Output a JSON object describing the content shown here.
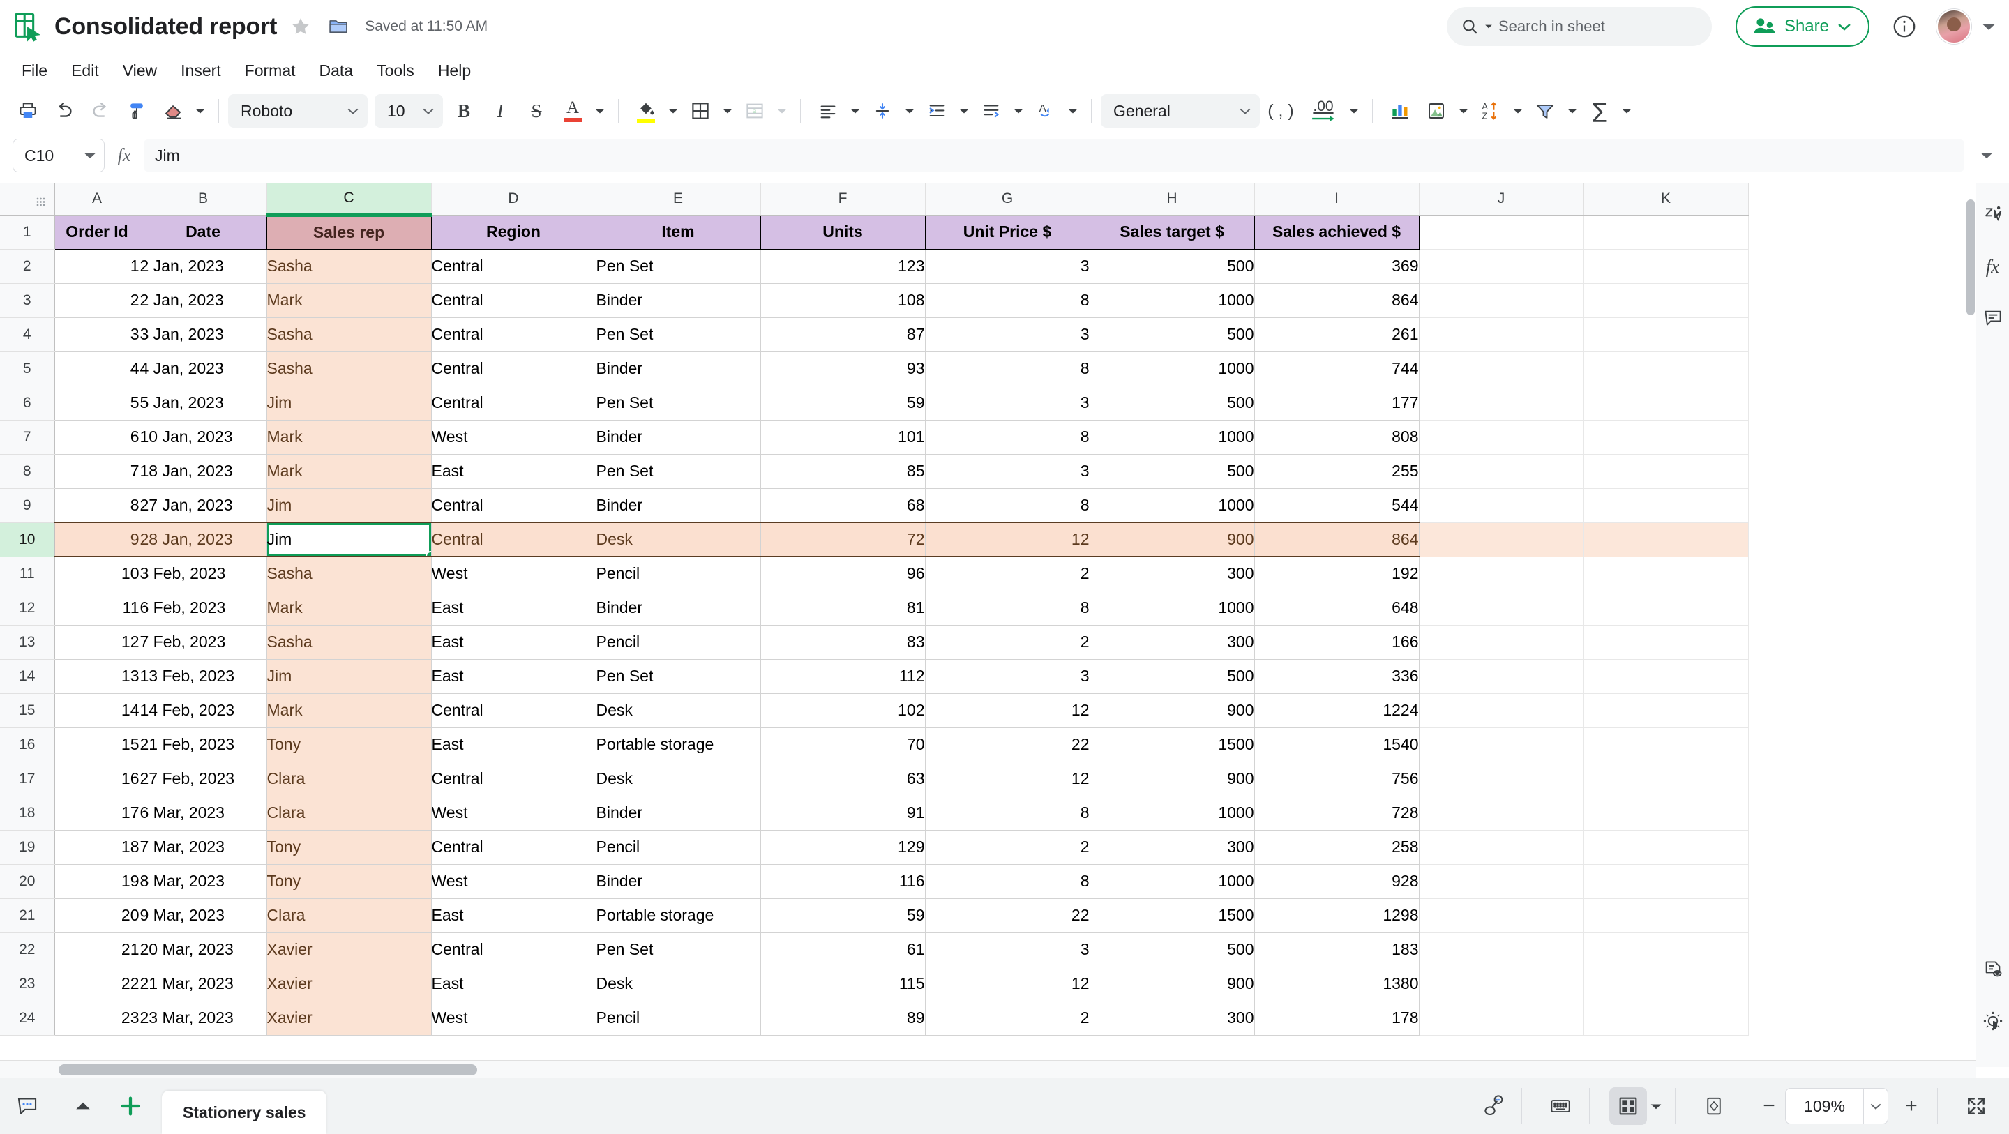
{
  "header": {
    "doc_title": "Consolidated report",
    "saved_status": "Saved at 11:50 AM",
    "star_icon": "star-icon",
    "folder_icon": "folder-icon",
    "logo_icon": "sheets-logo-icon",
    "search_placeholder": "Search in sheet",
    "search_icon": "search-icon",
    "share_label": "Share",
    "share_icon": "people-icon",
    "info_icon": "info-icon",
    "avatar_name": "avatar",
    "accent_green": "#0f9d58"
  },
  "menubar": {
    "items": [
      {
        "label": "File"
      },
      {
        "label": "Edit"
      },
      {
        "label": "View"
      },
      {
        "label": "Insert"
      },
      {
        "label": "Format"
      },
      {
        "label": "Data"
      },
      {
        "label": "Tools"
      },
      {
        "label": "Help"
      }
    ]
  },
  "toolbar": {
    "print_icon": "print-icon",
    "undo_icon": "undo-icon",
    "redo_icon": "redo-icon",
    "paint_format_icon": "paint-roller-icon",
    "clear_format_icon": "eraser-icon",
    "font_family": "Roboto",
    "font_size": "10",
    "bold_label": "B",
    "italic_label": "I",
    "strikethrough_label": "S",
    "text_color_label": "A",
    "text_color": "#ea4335",
    "fill_color_icon": "paint-bucket-icon",
    "fill_color": "#ffff00",
    "borders_icon": "borders-icon",
    "merge_icon": "merge-cells-icon",
    "halign_icon": "horizontal-align-icon",
    "valign_icon": "vertical-align-icon",
    "indent_icon": "indent-icon",
    "wrap_icon": "text-wrap-icon",
    "rotate_icon": "text-rotation-icon",
    "number_format": "General",
    "comma_label": "( , )",
    "decimal_label": ".00",
    "chart_icon": "insert-chart-icon",
    "image_icon": "insert-image-icon",
    "sort_icon": "sort-az-icon",
    "filter_icon": "filter-funnel-icon",
    "functions_label": "∑"
  },
  "formulabar": {
    "name_box": "C10",
    "fx_label": "fx",
    "formula_value": "Jim"
  },
  "grid": {
    "columns": [
      "A",
      "B",
      "C",
      "D",
      "E",
      "F",
      "G",
      "H",
      "I",
      "J",
      "K"
    ],
    "selected_column": "C",
    "selected_row": 10,
    "active_cell": "C10",
    "headers": [
      "Order Id",
      "Date",
      "Sales rep",
      "Region",
      "Item",
      "Units",
      "Unit Price $",
      "Sales target $",
      "Sales achieved $"
    ],
    "rows": [
      {
        "n": 2,
        "order_id": "1",
        "date": "2 Jan, 2023",
        "rep": "Sasha",
        "region": "Central",
        "item": "Pen Set",
        "units": "123",
        "price": "3",
        "target": "500",
        "achieved": "369"
      },
      {
        "n": 3,
        "order_id": "2",
        "date": "2 Jan, 2023",
        "rep": "Mark",
        "region": "Central",
        "item": "Binder",
        "units": "108",
        "price": "8",
        "target": "1000",
        "achieved": "864"
      },
      {
        "n": 4,
        "order_id": "3",
        "date": "3 Jan, 2023",
        "rep": "Sasha",
        "region": "Central",
        "item": "Pen Set",
        "units": "87",
        "price": "3",
        "target": "500",
        "achieved": "261"
      },
      {
        "n": 5,
        "order_id": "4",
        "date": "4 Jan, 2023",
        "rep": "Sasha",
        "region": "Central",
        "item": "Binder",
        "units": "93",
        "price": "8",
        "target": "1000",
        "achieved": "744"
      },
      {
        "n": 6,
        "order_id": "5",
        "date": "5 Jan, 2023",
        "rep": "Jim",
        "region": "Central",
        "item": "Pen Set",
        "units": "59",
        "price": "3",
        "target": "500",
        "achieved": "177"
      },
      {
        "n": 7,
        "order_id": "6",
        "date": "10 Jan, 2023",
        "rep": "Mark",
        "region": "West",
        "item": "Binder",
        "units": "101",
        "price": "8",
        "target": "1000",
        "achieved": "808"
      },
      {
        "n": 8,
        "order_id": "7",
        "date": "18 Jan, 2023",
        "rep": "Mark",
        "region": "East",
        "item": "Pen Set",
        "units": "85",
        "price": "3",
        "target": "500",
        "achieved": "255"
      },
      {
        "n": 9,
        "order_id": "8",
        "date": "27 Jan, 2023",
        "rep": "Jim",
        "region": "Central",
        "item": "Binder",
        "units": "68",
        "price": "8",
        "target": "1000",
        "achieved": "544"
      },
      {
        "n": 10,
        "order_id": "9",
        "date": "28 Jan, 2023",
        "rep": "Jim",
        "region": "Central",
        "item": "Desk",
        "units": "72",
        "price": "12",
        "target": "900",
        "achieved": "864",
        "selected": true
      },
      {
        "n": 11,
        "order_id": "10",
        "date": "3 Feb, 2023",
        "rep": "Sasha",
        "region": "West",
        "item": "Pencil",
        "units": "96",
        "price": "2",
        "target": "300",
        "achieved": "192"
      },
      {
        "n": 12,
        "order_id": "11",
        "date": "6 Feb, 2023",
        "rep": "Mark",
        "region": "East",
        "item": "Binder",
        "units": "81",
        "price": "8",
        "target": "1000",
        "achieved": "648"
      },
      {
        "n": 13,
        "order_id": "12",
        "date": "7 Feb, 2023",
        "rep": "Sasha",
        "region": "East",
        "item": "Pencil",
        "units": "83",
        "price": "2",
        "target": "300",
        "achieved": "166"
      },
      {
        "n": 14,
        "order_id": "13",
        "date": "13 Feb, 2023",
        "rep": "Jim",
        "region": "East",
        "item": "Pen Set",
        "units": "112",
        "price": "3",
        "target": "500",
        "achieved": "336"
      },
      {
        "n": 15,
        "order_id": "14",
        "date": "14 Feb, 2023",
        "rep": "Mark",
        "region": "Central",
        "item": "Desk",
        "units": "102",
        "price": "12",
        "target": "900",
        "achieved": "1224"
      },
      {
        "n": 16,
        "order_id": "15",
        "date": "21 Feb, 2023",
        "rep": "Tony",
        "region": "East",
        "item": "Portable storage",
        "units": "70",
        "price": "22",
        "target": "1500",
        "achieved": "1540"
      },
      {
        "n": 17,
        "order_id": "16",
        "date": "27 Feb, 2023",
        "rep": "Clara",
        "region": "Central",
        "item": "Desk",
        "units": "63",
        "price": "12",
        "target": "900",
        "achieved": "756"
      },
      {
        "n": 18,
        "order_id": "17",
        "date": "6 Mar, 2023",
        "rep": "Clara",
        "region": "West",
        "item": "Binder",
        "units": "91",
        "price": "8",
        "target": "1000",
        "achieved": "728"
      },
      {
        "n": 19,
        "order_id": "18",
        "date": "7 Mar, 2023",
        "rep": "Tony",
        "region": "Central",
        "item": "Pencil",
        "units": "129",
        "price": "2",
        "target": "300",
        "achieved": "258"
      },
      {
        "n": 20,
        "order_id": "19",
        "date": "8 Mar, 2023",
        "rep": "Tony",
        "region": "West",
        "item": "Binder",
        "units": "116",
        "price": "8",
        "target": "1000",
        "achieved": "928"
      },
      {
        "n": 21,
        "order_id": "20",
        "date": "9 Mar, 2023",
        "rep": "Clara",
        "region": "East",
        "item": "Portable storage",
        "units": "59",
        "price": "22",
        "target": "1500",
        "achieved": "1298"
      },
      {
        "n": 22,
        "order_id": "21",
        "date": "20 Mar, 2023",
        "rep": "Xavier",
        "region": "Central",
        "item": "Pen Set",
        "units": "61",
        "price": "3",
        "target": "500",
        "achieved": "183"
      },
      {
        "n": 23,
        "order_id": "22",
        "date": "21 Mar, 2023",
        "rep": "Xavier",
        "region": "East",
        "item": "Desk",
        "units": "115",
        "price": "12",
        "target": "900",
        "achieved": "1380"
      },
      {
        "n": 24,
        "order_id": "23",
        "date": "23 Mar, 2023",
        "rep": "Xavier",
        "region": "West",
        "item": "Pencil",
        "units": "89",
        "price": "2",
        "target": "300",
        "achieved": "178"
      }
    ],
    "colors": {
      "header_fill": "#d5bfe4",
      "header_salesrep_fill": "#ddaeb3",
      "column_c_fill": "#fbe3d4",
      "selected_row_fill": "#fbe0d0",
      "selected_header_fill": "#d3f0dc"
    }
  },
  "rightrail": {
    "items": [
      {
        "icon": "zio-assistant-icon"
      },
      {
        "icon": "fx-functions-icon"
      },
      {
        "icon": "comment-panel-icon"
      }
    ],
    "bottom_items": [
      {
        "icon": "document-preview-icon"
      },
      {
        "icon": "theme-brightness-icon"
      }
    ]
  },
  "bottombar": {
    "comment_icon": "comment-bubble-icon",
    "all_sheets_icon": "all-sheets-icon",
    "add_sheet_icon": "add-sheet-icon",
    "sheet_tabs": [
      {
        "label": "Stationery sales",
        "active": true
      }
    ],
    "record_macro_icon": "record-macro-icon",
    "keyboard_icon": "keyboard-icon",
    "freeze_icon": "freeze-panes-icon",
    "fit_icon": "fit-to-screen-icon",
    "zoom_out_label": "−",
    "zoom_value": "109%",
    "zoom_in_label": "+",
    "fullscreen_icon": "fullscreen-icon"
  }
}
